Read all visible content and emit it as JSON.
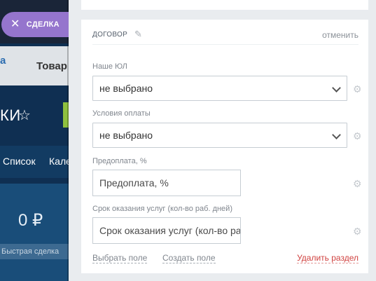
{
  "background": {
    "tab_active": "a",
    "tab_goods": "Товар",
    "title": "КИ",
    "view_list": "Список",
    "view_calendar": "Кале",
    "column_sum": "0 ₽",
    "quick_deal": "Быстрая сделка"
  },
  "deal_tag": {
    "label": "СДЕЛКА"
  },
  "section": {
    "title": "ДОГОВОР",
    "cancel": "отменить",
    "fields": [
      {
        "label": "Наше ЮЛ",
        "value": "не выбрано"
      },
      {
        "label": "Условия оплаты",
        "value": "не выбрано"
      },
      {
        "label": "Предоплата, %",
        "placeholder": "Предоплата, %"
      },
      {
        "label": "Срок оказания услуг (кол-во раб. дней)",
        "placeholder": "Срок оказания услуг (кол-во раб. дней)"
      }
    ],
    "footer": {
      "select_field": "Выбрать поле",
      "create_field": "Создать поле",
      "delete_section": "Удалить раздел"
    }
  },
  "colors": {
    "accent": "#9575cd",
    "danger": "#d0413f",
    "page_bg": "#0f2f52"
  }
}
